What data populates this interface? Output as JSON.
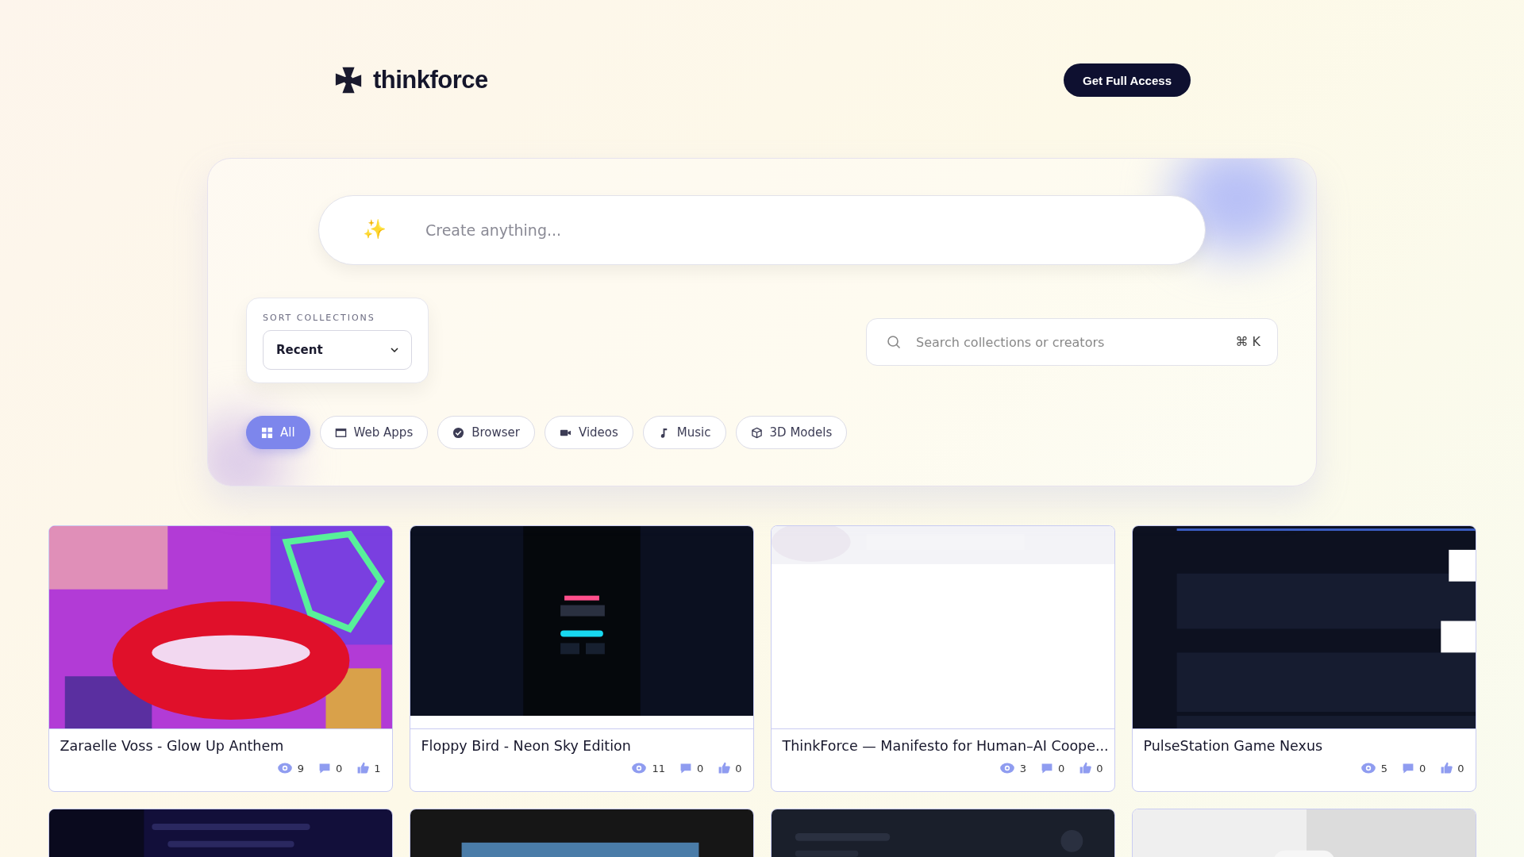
{
  "header": {
    "logo_text": "thinkforce",
    "cta": "Get Full Access"
  },
  "prompt": {
    "icon": "✨",
    "placeholder": "Create anything..."
  },
  "sort": {
    "label": "SORT COLLECTIONS",
    "value": "Recent"
  },
  "search": {
    "placeholder": "Search collections or creators",
    "shortcut": "⌘ K"
  },
  "filters": [
    {
      "label": "All",
      "selected": true
    },
    {
      "label": "Web Apps",
      "selected": false
    },
    {
      "label": "Browser",
      "selected": false
    },
    {
      "label": "Videos",
      "selected": false
    },
    {
      "label": "Music",
      "selected": false
    },
    {
      "label": "3D Models",
      "selected": false
    }
  ],
  "cards": [
    {
      "thumbnail": {
        "kind": "picture"
      },
      "title": "Zaraelle Voss - Glow Up Anthem",
      "views": "9",
      "comments": "0",
      "likes": "1"
    },
    {
      "thumbnail": {
        "kind": "picture"
      },
      "title": "Floppy Bird - Neon Sky Edition",
      "views": "11",
      "comments": "0",
      "likes": "0"
    },
    {
      "thumbnail": {
        "kind": "picture"
      },
      "title": "ThinkForce — Manifesto for Human–AI Coope...",
      "views": "3",
      "comments": "0",
      "likes": "0"
    },
    {
      "thumbnail": {
        "kind": "picture"
      },
      "title": "PulseStation Game Nexus",
      "views": "5",
      "comments": "0",
      "likes": "0"
    },
    {
      "thumbnail": {
        "kind": "picture"
      }
    },
    {
      "thumbnail": {
        "kind": "picture"
      }
    },
    {
      "thumbnail": {
        "kind": "picture"
      }
    },
    {
      "thumbnail": {
        "kind": "picture"
      }
    }
  ]
}
